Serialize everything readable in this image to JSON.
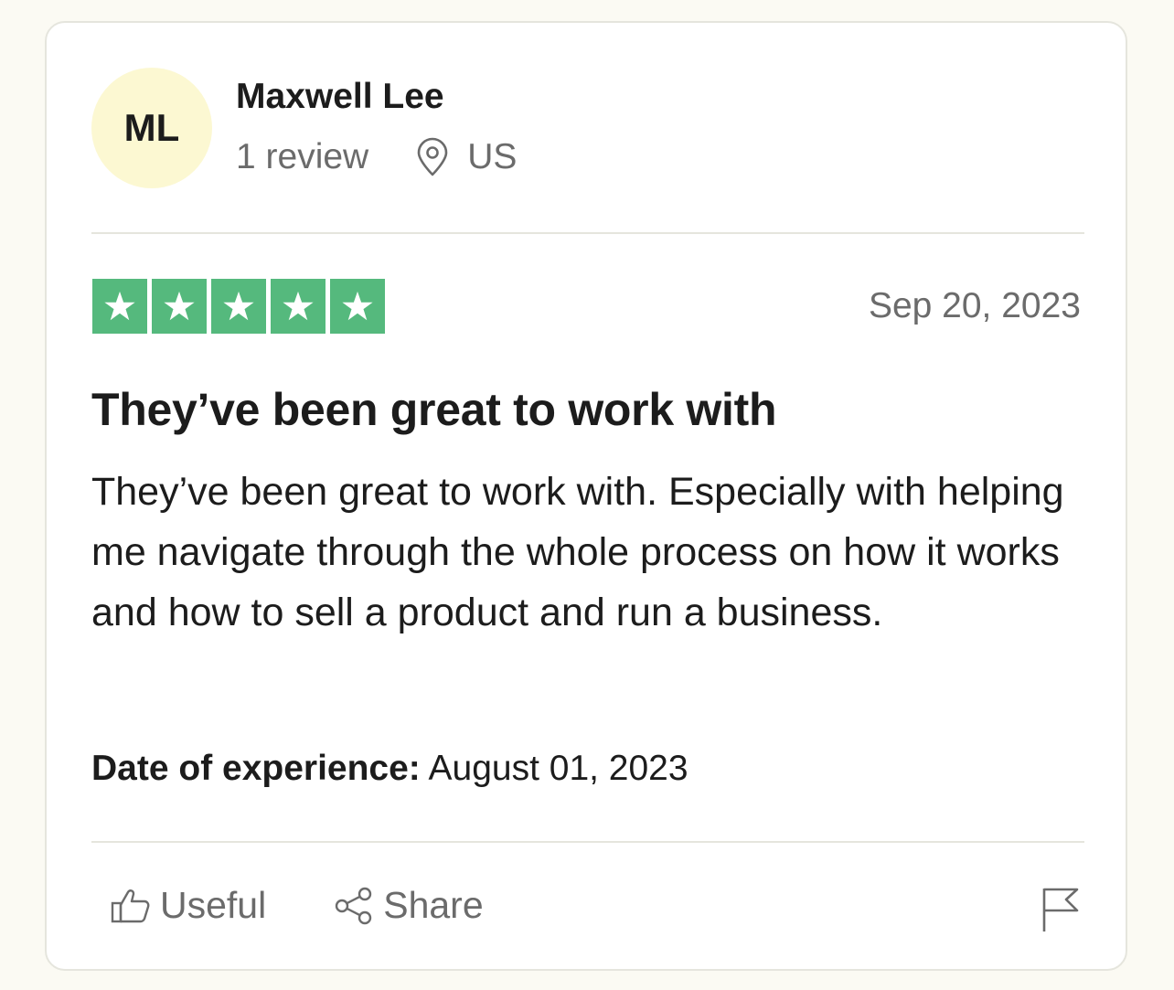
{
  "reviewer": {
    "initials": "ML",
    "name": "Maxwell Lee",
    "review_count": "1 review",
    "location": "US",
    "avatar_color": "#fcf8d2"
  },
  "review": {
    "rating": 5,
    "rating_max": 5,
    "star_color": "#55b97d",
    "date": "Sep 20, 2023",
    "title": "They’ve been great to work with",
    "body": "They’ve been great to work with. Especially with helping me navigate through the whole process on how it works and how to sell a product and run a business.",
    "experience_label": "Date of experience:",
    "experience_date": "August 01, 2023"
  },
  "actions": {
    "useful_label": "Useful",
    "share_label": "Share",
    "useful_icon": "thumbs-up-icon",
    "share_icon": "share-icon",
    "flag_icon": "flag-icon"
  }
}
